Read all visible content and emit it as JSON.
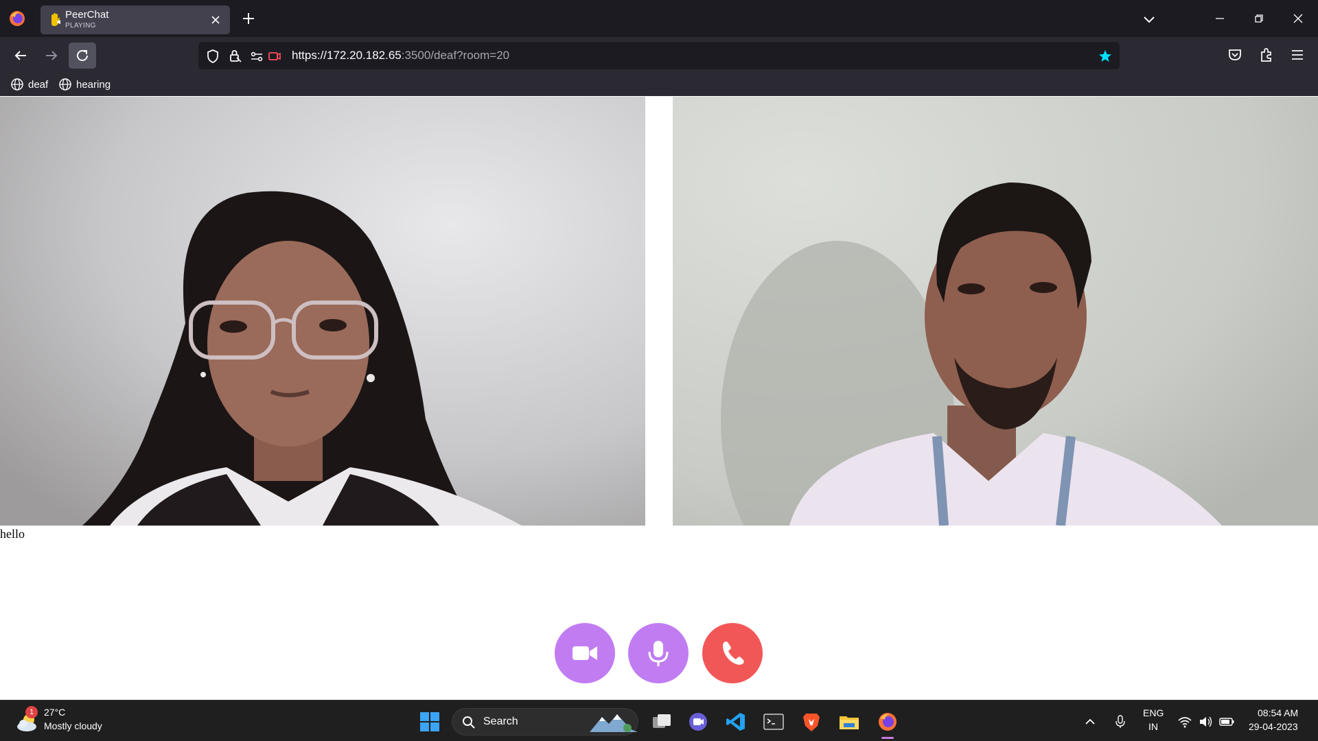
{
  "browser": {
    "tab": {
      "title": "PeerChat",
      "status": "PLAYING"
    },
    "url": {
      "host_part": "https://172.20.182.65",
      "path_part": ":3500/deaf?room=20"
    },
    "bookmarks": [
      "deaf",
      "hearing"
    ]
  },
  "page": {
    "caption": "hello",
    "controls": [
      {
        "name": "camera",
        "color": "#c17cf2"
      },
      {
        "name": "microphone",
        "color": "#c17cf2"
      },
      {
        "name": "hang-up",
        "color": "#f25757"
      }
    ]
  },
  "taskbar": {
    "weather": {
      "badge": "1",
      "temp": "27°C",
      "desc": "Mostly cloudy"
    },
    "search_label": "Search",
    "language": {
      "line1": "ENG",
      "line2": "IN"
    },
    "time": "08:54 AM",
    "date": "29-04-2023"
  }
}
